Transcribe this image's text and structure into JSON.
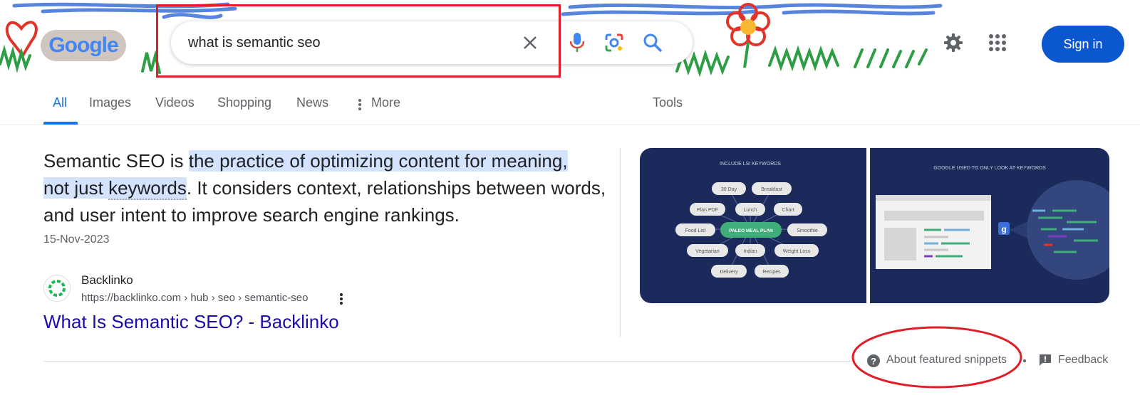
{
  "search": {
    "query": "what is semantic seo",
    "clear_icon": "close-icon",
    "voice_icon": "microphone-icon",
    "lens_icon": "camera-lens-icon",
    "search_icon": "search-icon"
  },
  "header": {
    "logo_text": "Google",
    "settings_icon": "gear-icon",
    "apps_icon": "apps-grid-icon",
    "sign_in_label": "Sign in"
  },
  "tabs": [
    {
      "label": "All",
      "active": true
    },
    {
      "label": "Images"
    },
    {
      "label": "Videos"
    },
    {
      "label": "Shopping"
    },
    {
      "label": "News"
    },
    {
      "label": "More"
    },
    {
      "label": "Tools"
    }
  ],
  "snippet": {
    "lead": "Semantic SEO is ",
    "highlight_1": "the practice of optimizing content for meaning,",
    "highlight_2": "not just ",
    "highlight_3": "keywords",
    "rest": ". It considers context, relationships between words, and user intent to improve search engine rankings.",
    "date": "15-Nov-2023"
  },
  "result": {
    "site_name": "Backlinko",
    "url": "https://backlinko.com › hub › seo › semantic-seo",
    "title": "What Is Semantic SEO? - Backlinko"
  },
  "images": {
    "left_title": "INCLUDE LSI KEYWORDS",
    "right_title": "GOOGLE USED TO ONLY LOOK AT KEYWORDS",
    "bubbles": [
      "30 Day",
      "Breakfast",
      "Plan PDF",
      "Lunch",
      "Chart",
      "Food List",
      "PALEO MEAL PLAN",
      "Smoothie",
      "Vegetarian",
      "Indian",
      "Weight Loss",
      "Delivery",
      "Recipes"
    ]
  },
  "footer": {
    "about_label": "About featured snippets",
    "feedback_label": "Feedback"
  },
  "colors": {
    "accent": "#1a73e8",
    "link": "#1a0dab",
    "sign_in_bg": "#0b57d0",
    "highlight": "#d3e3fd",
    "annotation": "#e01e2a",
    "image_bg": "#1b2a5a"
  }
}
